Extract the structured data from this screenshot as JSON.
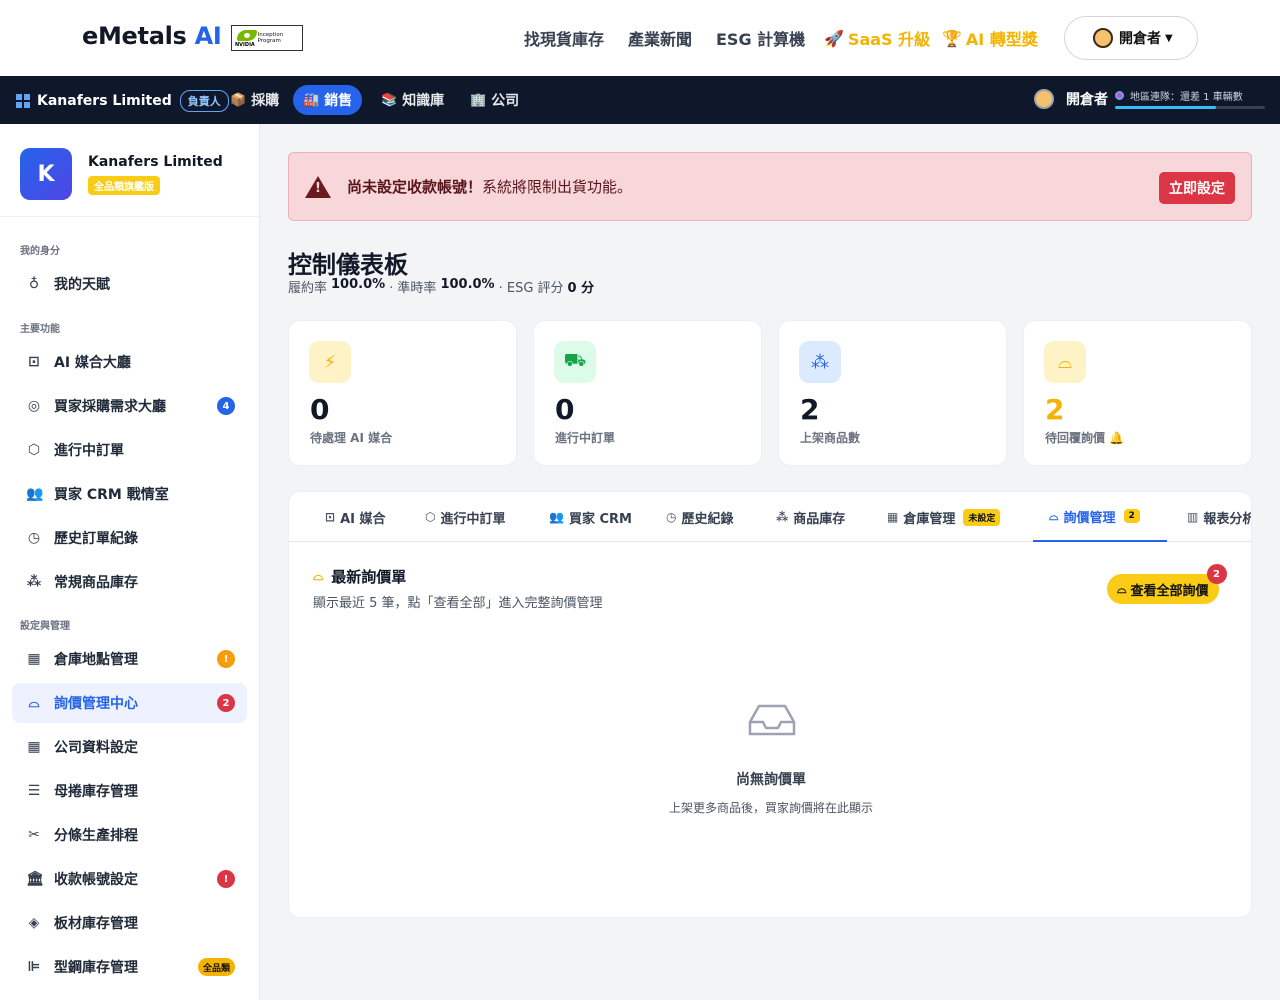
{
  "header": {
    "brand_main": "eMetals",
    "brand_ai": "AI",
    "badge_text": "Inception Program",
    "badge_logo": "NVIDIA",
    "nav": [
      {
        "label": "找現貨庫存",
        "highlight": false
      },
      {
        "label": "產業新聞",
        "highlight": false
      },
      {
        "label": "ESG 計算機",
        "highlight": false
      },
      {
        "label": "SaaS 升級",
        "highlight": true,
        "icon": "rocket-icon"
      },
      {
        "label": "AI 轉型獎",
        "highlight": true,
        "icon": "trophy-icon"
      }
    ],
    "user_label": "開倉者"
  },
  "darkbar": {
    "company": "Kanafers Limited",
    "role": "負責人",
    "tabs": [
      {
        "label": "採購",
        "icon": "box-icon",
        "active": false
      },
      {
        "label": "銷售",
        "icon": "factory-icon",
        "active": true
      },
      {
        "label": "知識庫",
        "icon": "books-icon",
        "active": false
      },
      {
        "label": "公司",
        "icon": "building-icon",
        "active": false
      }
    ],
    "user": "開倉者",
    "progress_label": "地區連隊：還差 1 車輛數",
    "progress_fraction": 0.67
  },
  "sidebar": {
    "company": "Kanafers Limited",
    "logo_letter": "K",
    "plan": "全品類旗艦版",
    "sections": {
      "identity": "我的身分",
      "main": "主要功能",
      "settings": "設定與管理"
    },
    "items": [
      {
        "label": "我的天賦",
        "icon": "badge-icon",
        "badge": ""
      },
      {
        "label": "AI 媒合大廳",
        "icon": "robot-icon",
        "badge": ""
      },
      {
        "label": "買家採購需求大廳",
        "icon": "target-icon",
        "badge": "4"
      },
      {
        "label": "進行中訂單",
        "icon": "cube-icon",
        "badge": ""
      },
      {
        "label": "買家 CRM 戰情室",
        "icon": "people-icon",
        "badge": ""
      },
      {
        "label": "歷史訂單紀錄",
        "icon": "clock-icon",
        "badge": ""
      },
      {
        "label": "常規商品庫存",
        "icon": "boxes-icon",
        "badge": ""
      },
      {
        "label": "倉庫地點管理",
        "icon": "building-icon",
        "badge": "!"
      },
      {
        "label": "詢價管理中心",
        "icon": "inbox-icon",
        "badge": "2"
      },
      {
        "label": "公司資料設定",
        "icon": "building-icon",
        "badge": ""
      },
      {
        "label": "母捲庫存管理",
        "icon": "database-icon",
        "badge": ""
      },
      {
        "label": "分條生產排程",
        "icon": "scissors-icon",
        "badge": ""
      },
      {
        "label": "收款帳號設定",
        "icon": "bank-icon",
        "badge": "!"
      },
      {
        "label": "板材庫存管理",
        "icon": "layers-icon",
        "badge": ""
      },
      {
        "label": "型鋼庫存管理",
        "icon": "hierarchy-icon",
        "badge": "全品類"
      }
    ]
  },
  "alert": {
    "bold": "尚未設定收款帳號！",
    "text": "系統將限制出貨功能。",
    "button": "立即設定"
  },
  "dashboard": {
    "title": "控制儀表板",
    "fulfill_label": "履約率",
    "fulfill_value": "100.0%",
    "ontime_label": "· 準時率",
    "ontime_value": "100.0%",
    "esg_label": "· ESG 評分",
    "esg_value": "0 分"
  },
  "cards": [
    {
      "value": "0",
      "label": "待處理 AI 媒合",
      "icon": "lightning-icon",
      "color": "#f5b301",
      "bg": "#fef3c7"
    },
    {
      "value": "0",
      "label": "進行中訂單",
      "icon": "truck-icon",
      "color": "#16a34a",
      "bg": "#dcfce7"
    },
    {
      "value": "2",
      "label": "上架商品數",
      "icon": "boxes-icon",
      "color": "#2563eb",
      "bg": "#dbeafe"
    },
    {
      "value": "2",
      "label": "待回覆詢價 🔔",
      "icon": "inbox-icon",
      "color": "#f5b301",
      "bg": "#fef3c7"
    }
  ],
  "panel": {
    "tabs": [
      {
        "label": "AI 媒合",
        "icon": "robot-icon",
        "badge": ""
      },
      {
        "label": "進行中訂單",
        "icon": "cube-icon",
        "badge": ""
      },
      {
        "label": "買家 CRM",
        "icon": "people-icon",
        "badge": ""
      },
      {
        "label": "歷史紀錄",
        "icon": "clock-icon",
        "badge": ""
      },
      {
        "label": "商品庫存",
        "icon": "boxes-icon",
        "badge": ""
      },
      {
        "label": "倉庫管理",
        "icon": "building-icon",
        "badge": "未設定"
      },
      {
        "label": "詢價管理",
        "icon": "inbox-icon",
        "badge": "2"
      },
      {
        "label": "報表分析",
        "icon": "chart-icon",
        "badge": ""
      }
    ],
    "section_title": "最新詢價單",
    "section_sub": "顯示最近 5 筆，點「查看全部」進入完整詢價管理",
    "view_all": "查看全部詢價",
    "view_all_count": "2",
    "empty_title": "尚無詢價單",
    "empty_sub": "上架更多商品後，買家詢價將在此顯示"
  }
}
